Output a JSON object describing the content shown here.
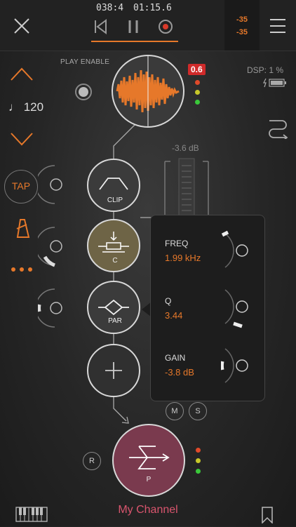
{
  "transport": {
    "position": "038:4",
    "time": "01:15.6"
  },
  "meter": {
    "left": "-35",
    "right": "-35"
  },
  "play_enable": "PLAY ENABLE",
  "clip_badge": "0.6",
  "dsp": "DSP: 1 %",
  "tempo": "♩ 120",
  "tap": "TAP",
  "fader_db": "-3.6 dB",
  "nodes": {
    "clip": "CLIP",
    "c": "C",
    "par": "PAR",
    "p": "P"
  },
  "params": [
    {
      "name": "FREQ",
      "value": "1.99 kHz"
    },
    {
      "name": "Q",
      "value": "3.44"
    },
    {
      "name": "GAIN",
      "value": "-3.8 dB"
    }
  ],
  "buttons": {
    "mute": "M",
    "solo": "S",
    "record": "R"
  },
  "channel_name": "My Channel",
  "colors": {
    "accent": "#e6782a",
    "channel": "#7a3a4e",
    "eq_node": "#6e6446",
    "led_red": "#e04a2a",
    "led_yellow": "#c8c82a",
    "led_green": "#3ac83a"
  }
}
